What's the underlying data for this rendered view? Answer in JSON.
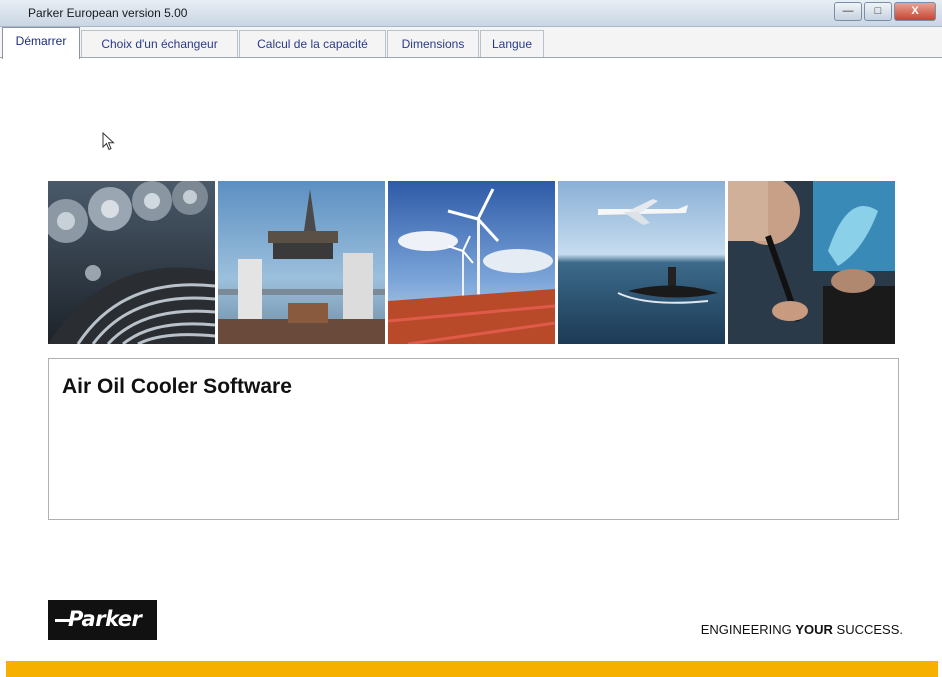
{
  "window": {
    "title": "Parker European version  5.00",
    "minimize_label": "—",
    "maximize_label": "□",
    "close_label": "X"
  },
  "tabs": [
    {
      "label": "Démarrer",
      "active": true
    },
    {
      "label": "Choix d'un échangeur",
      "active": false
    },
    {
      "label": "Calcul de la capacité",
      "active": false
    },
    {
      "label": "Dimensions",
      "active": false
    },
    {
      "label": "Langue",
      "active": false
    }
  ],
  "banner_images": [
    "industrial-gears",
    "offshore-oil-rig",
    "wind-turbines",
    "aircraft-submarine",
    "engineer-workstation"
  ],
  "main": {
    "title": "Air Oil Cooler Software"
  },
  "footer": {
    "logo_text": "Parker",
    "tagline_pre": "ENGINEERING ",
    "tagline_bold": "YOUR",
    "tagline_post": " SUCCESS."
  },
  "colors": {
    "accent_bar": "#f5b000",
    "tab_text": "#2a3a8a"
  }
}
